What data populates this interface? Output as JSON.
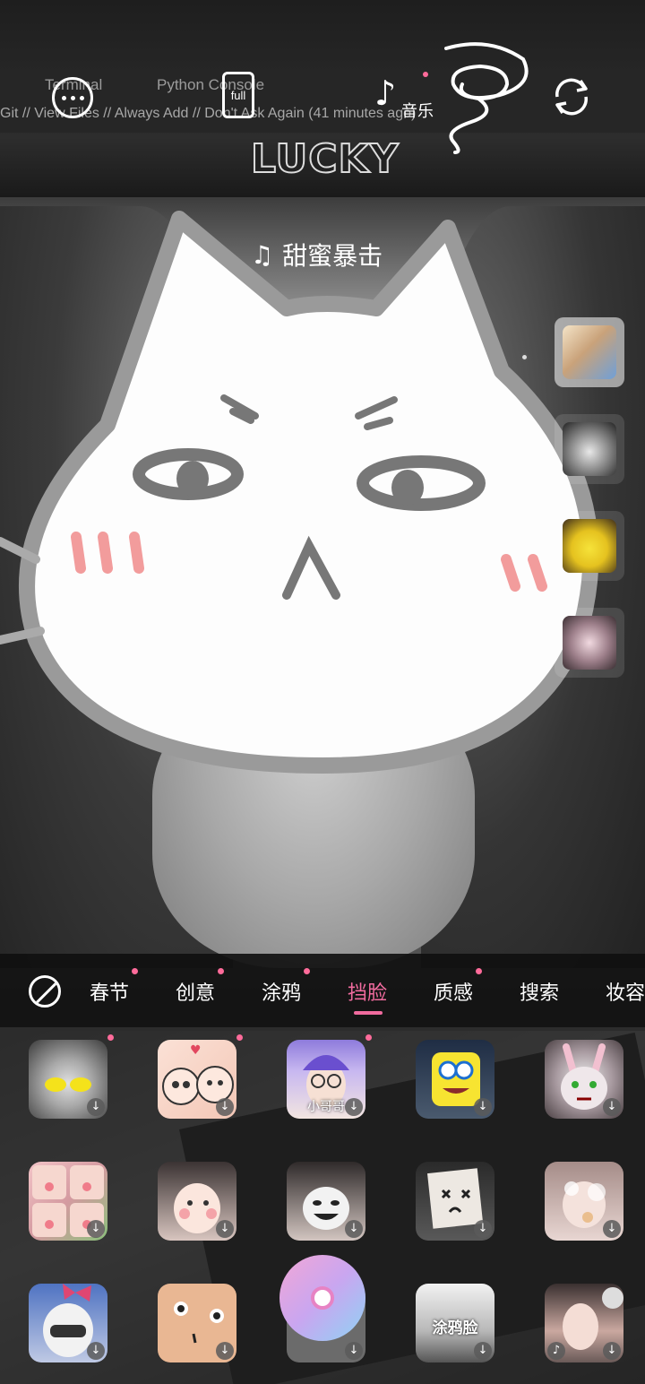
{
  "background": {
    "monitor_tab_terminal": "Terminal",
    "monitor_tab_python": "Python Console",
    "monitor_status": "Git // View Files // Always Add // Don't Ask Again (41 minutes ago)",
    "lucky_text": "LUCKY"
  },
  "top_bar": {
    "full_label": "full",
    "music_label": "音乐"
  },
  "song": {
    "title": "甜蜜暴击"
  },
  "tabs": [
    {
      "label": "春节",
      "new": true
    },
    {
      "label": "创意",
      "new": true
    },
    {
      "label": "涂鸦",
      "new": true
    },
    {
      "label": "挡脸",
      "new": false,
      "active": true
    },
    {
      "label": "质感",
      "new": true
    },
    {
      "label": "搜索",
      "new": false
    },
    {
      "label": "妆容",
      "new": false
    }
  ],
  "effects": [
    {
      "name": "ultraman-mask",
      "caption": ""
    },
    {
      "name": "cartoon-couple",
      "caption": ""
    },
    {
      "name": "xiaogege",
      "caption": "小哥哥"
    },
    {
      "name": "spongebob-face",
      "caption": ""
    },
    {
      "name": "bunny-mask",
      "caption": ""
    },
    {
      "name": "blush-collage",
      "caption": ""
    },
    {
      "name": "cute-cartoon-face",
      "caption": ""
    },
    {
      "name": "smile-mask",
      "caption": ""
    },
    {
      "name": "x-face-paper",
      "caption": ""
    },
    {
      "name": "sparkle-blur",
      "caption": ""
    },
    {
      "name": "helmet-bow",
      "caption": ""
    },
    {
      "name": "cardboard-face",
      "caption": ""
    },
    {
      "name": "hidden-under-shutter",
      "caption": ""
    },
    {
      "name": "doodle-face",
      "caption": "涂鸦脸"
    },
    {
      "name": "beauty-girl",
      "caption": ""
    }
  ],
  "colors": {
    "accent": "#f06b9e",
    "new_dot": "#ff6b9a"
  }
}
